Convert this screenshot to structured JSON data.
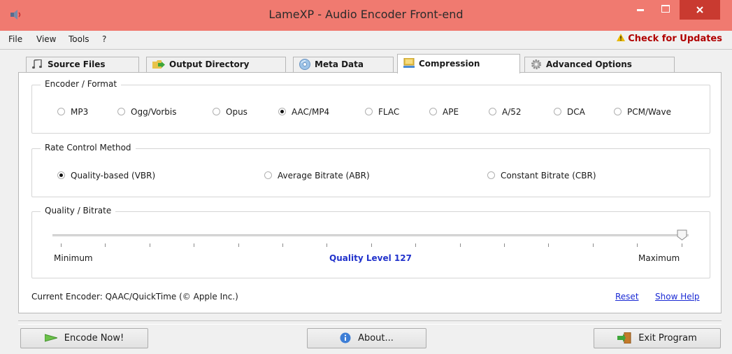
{
  "window": {
    "title": "LameXP - Audio Encoder Front-end"
  },
  "menu": {
    "items": [
      "File",
      "View",
      "Tools",
      "?"
    ],
    "update_link": "Check for Updates"
  },
  "tabs": [
    {
      "label": "Source Files",
      "icon": "music-files-icon"
    },
    {
      "label": "Output Directory",
      "icon": "folder-arrow-icon"
    },
    {
      "label": "Meta Data",
      "icon": "cd-icon"
    },
    {
      "label": "Compression",
      "icon": "compress-icon",
      "active": true
    },
    {
      "label": "Advanced Options",
      "icon": "gear-icon"
    }
  ],
  "encoder_format": {
    "title": "Encoder / Format",
    "options": [
      "MP3",
      "Ogg/Vorbis",
      "Opus",
      "AAC/MP4",
      "FLAC",
      "APE",
      "A/52",
      "DCA",
      "PCM/Wave"
    ],
    "selected": "AAC/MP4"
  },
  "rate_control": {
    "title": "Rate Control Method",
    "options": [
      "Quality-based (VBR)",
      "Average Bitrate (ABR)",
      "Constant Bitrate (CBR)"
    ],
    "selected": "Quality-based (VBR)"
  },
  "quality": {
    "title": "Quality / Bitrate",
    "min_label": "Minimum",
    "max_label": "Maximum",
    "value_label": "Quality Level 127",
    "slider_position": 1.0
  },
  "footer": {
    "current_encoder": "Current Encoder: QAAC/QuickTime (© Apple Inc.)",
    "reset": "Reset",
    "show_help": "Show Help"
  },
  "buttons": {
    "encode": "Encode Now!",
    "about": "About...",
    "exit": "Exit Program"
  },
  "colors": {
    "titlebar": "#f07a70",
    "close_button": "#c93a30",
    "link": "#1a2ad4",
    "quality_text": "#2233cc",
    "update_text": "#b00000"
  }
}
